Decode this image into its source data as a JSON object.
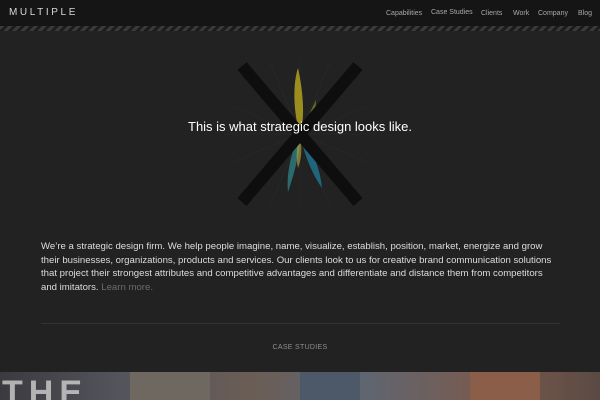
{
  "header": {
    "logo": "MULTIPLE",
    "nav": [
      {
        "label": "Capabilities"
      },
      {
        "label": "Case Studies"
      },
      {
        "label": "Clients"
      },
      {
        "label": "Work"
      },
      {
        "label": "Company"
      },
      {
        "label": "Blog"
      }
    ]
  },
  "hero": {
    "tagline": "This is what strategic design looks like.",
    "graphic_icon": "x-starburst-icon"
  },
  "intro": {
    "text": "We’re a strategic design firm. We help people imagine, name, visualize, establish, position, market, energize and grow their businesses, organizations, products and services. Our clients look to us for creative brand communication solutions that project their strongest attributes and competitive advantages and differentiate and distance them from competitors and imitators.",
    "learn_more": "Learn more."
  },
  "case_studies": {
    "label": "CASE STUDIES",
    "image_letters": "THE"
  },
  "colors": {
    "background": "#222222",
    "header_bg": "#151515",
    "x_mark": "#0e0e0e",
    "petal_yellow": "#a99a1f",
    "petal_olive": "#6f7a22",
    "petal_blue": "#1f6d86",
    "petal_teal": "#2f8a8f",
    "link_muted": "#6c6c6c"
  }
}
